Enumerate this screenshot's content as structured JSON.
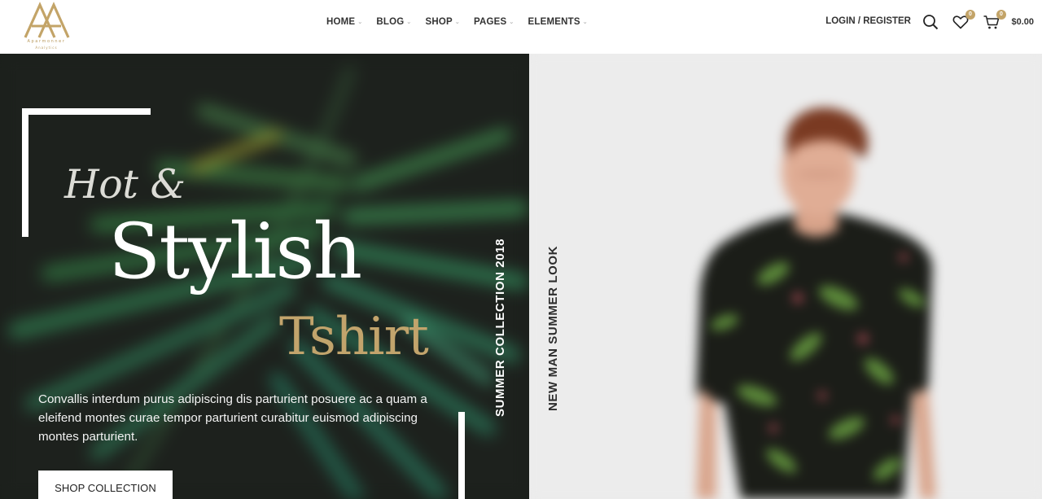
{
  "brand": {
    "line1": "Aparmonner",
    "line2": "Analytics",
    "accent_color": "#c3a468"
  },
  "nav": {
    "items": [
      {
        "label": "HOME"
      },
      {
        "label": "BLOG"
      },
      {
        "label": "SHOP"
      },
      {
        "label": "PAGES"
      },
      {
        "label": "ELEMENTS"
      }
    ]
  },
  "header": {
    "login_label": "LOGIN / REGISTER",
    "wishlist_count": "0",
    "cart_count": "0",
    "cart_total": "$0.00",
    "icons": [
      "search-icon",
      "heart-icon",
      "cart-icon"
    ]
  },
  "hero": {
    "hot": "Hot &",
    "stylish": "Stylish",
    "tshirt": "Tshirt",
    "description": "Convallis interdum purus adipiscing dis parturient posuere ac a quam a eleifend montes curae tempor parturient curabitur euismod adipiscing montes parturient.",
    "cta_label": "SHOP COLLECTION",
    "vertical_left": "SUMMER COLLECTION 2018",
    "vertical_right": "NEW MAN SUMMER LOOK"
  }
}
